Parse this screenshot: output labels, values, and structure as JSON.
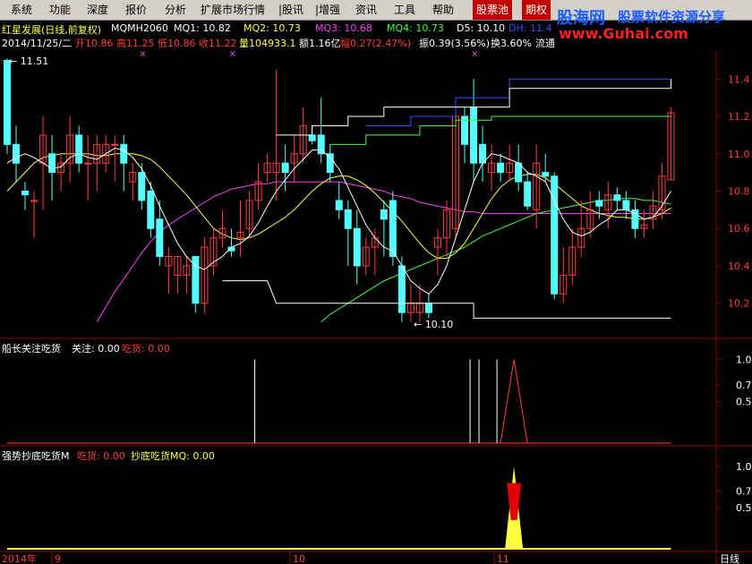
{
  "menu": [
    "系统",
    "功能",
    "深度",
    "报价",
    "分析",
    "扩展市场行情",
    "|股讯",
    "|增强",
    "资讯",
    "工具",
    "帮助",
    "股票池",
    "期权"
  ],
  "watermark": {
    "brand": "股海网",
    "slogan": "股票软件资源分享",
    "url": "www.Guhai.com"
  },
  "header": {
    "title": "红星发展(日线,前复权)",
    "mqmh": "MQMH2060",
    "mq1": "MQ1: 10.82",
    "mq2": "MQ2: 10.73",
    "mq3": "MQ3: 10.68",
    "mq4": "MQ4: 10.73",
    "d5": "D5: 10.10",
    "dh": "DH: 11.4"
  },
  "quote": {
    "date": "2014/11/25/二",
    "open": "开10.86",
    "high": "高11.25",
    "low": "低10.86",
    "close": "收11.22",
    "volume": "量104933.1",
    "amount": "额1.16亿",
    "change": "幅0.27(2.47%)",
    "swing": "振0.39(3.56%)",
    "turnover": "换3.60%",
    "float": "流通"
  },
  "annotations": {
    "max_label": "11.51",
    "min_label": "10.10"
  },
  "panel2": {
    "title": "船长关注吃货",
    "attention": "关注: 0.00",
    "eat": "吃货: 0.00"
  },
  "panel3": {
    "title": "强势抄底吃货M",
    "eat": "吃货: 0.00",
    "bottom": "抄底吃货MQ: 0.00"
  },
  "bottom_axis": {
    "year": "2014年",
    "months": [
      "9",
      "10",
      "11"
    ],
    "period": "日线"
  },
  "colors": {
    "up": "#ff3c3c",
    "down": "#54ffff",
    "ma_white": "#ffffff",
    "ma_yellow": "#ffff40",
    "ma_magenta": "#ff40ff",
    "ma_green": "#40ff40",
    "blue": "#3050ff",
    "grid": "#900000"
  },
  "chart_data": [
    {
      "type": "candlestick",
      "ylim": [
        10.05,
        11.55
      ],
      "yticks": [
        10.2,
        10.4,
        10.6,
        10.8,
        11.0,
        11.2,
        11.4
      ],
      "candles": [
        {
          "o": 11.5,
          "h": 11.51,
          "l": 11.0,
          "c": 11.05
        },
        {
          "o": 11.05,
          "h": 11.15,
          "l": 10.85,
          "c": 10.95
        },
        {
          "o": 10.8,
          "h": 10.85,
          "l": 10.7,
          "c": 10.78
        },
        {
          "o": 10.75,
          "h": 10.8,
          "l": 10.55,
          "c": 10.75
        },
        {
          "o": 10.95,
          "h": 11.2,
          "l": 10.7,
          "c": 11.1
        },
        {
          "o": 11.0,
          "h": 11.1,
          "l": 10.75,
          "c": 10.9
        },
        {
          "o": 10.9,
          "h": 11.0,
          "l": 10.8,
          "c": 10.95
        },
        {
          "o": 10.95,
          "h": 11.2,
          "l": 10.85,
          "c": 11.1
        },
        {
          "o": 11.1,
          "h": 11.15,
          "l": 10.9,
          "c": 10.95
        },
        {
          "o": 10.95,
          "h": 11.1,
          "l": 10.75,
          "c": 10.95
        },
        {
          "o": 10.95,
          "h": 11.1,
          "l": 10.8,
          "c": 11.05
        },
        {
          "o": 10.95,
          "h": 11.1,
          "l": 10.9,
          "c": 11.05
        },
        {
          "o": 11.05,
          "h": 11.1,
          "l": 10.85,
          "c": 11.05
        },
        {
          "o": 11.05,
          "h": 11.1,
          "l": 10.8,
          "c": 10.95
        },
        {
          "o": 10.85,
          "h": 10.95,
          "l": 10.75,
          "c": 10.9
        },
        {
          "o": 10.9,
          "h": 10.95,
          "l": 10.7,
          "c": 10.75
        },
        {
          "o": 10.8,
          "h": 10.85,
          "l": 10.55,
          "c": 10.6
        },
        {
          "o": 10.65,
          "h": 10.75,
          "l": 10.4,
          "c": 10.45
        },
        {
          "o": 10.4,
          "h": 10.5,
          "l": 10.25,
          "c": 10.45
        },
        {
          "o": 10.35,
          "h": 10.45,
          "l": 10.25,
          "c": 10.45
        },
        {
          "o": 10.35,
          "h": 10.45,
          "l": 10.25,
          "c": 10.4
        },
        {
          "o": 10.45,
          "h": 10.45,
          "l": 10.15,
          "c": 10.2
        },
        {
          "o": 10.2,
          "h": 10.55,
          "l": 10.15,
          "c": 10.5
        },
        {
          "o": 10.4,
          "h": 10.6,
          "l": 10.35,
          "c": 10.55
        },
        {
          "o": 10.55,
          "h": 10.7,
          "l": 10.5,
          "c": 10.6
        },
        {
          "o": 10.5,
          "h": 10.6,
          "l": 10.45,
          "c": 10.48
        },
        {
          "o": 10.55,
          "h": 10.75,
          "l": 10.45,
          "c": 10.58
        },
        {
          "o": 10.6,
          "h": 10.8,
          "l": 10.55,
          "c": 10.75
        },
        {
          "o": 10.75,
          "h": 10.95,
          "l": 10.7,
          "c": 10.85
        },
        {
          "o": 10.9,
          "h": 11.0,
          "l": 10.85,
          "c": 10.95
        },
        {
          "o": 10.9,
          "h": 11.45,
          "l": 10.75,
          "c": 10.95
        },
        {
          "o": 10.95,
          "h": 11.05,
          "l": 10.8,
          "c": 10.9
        },
        {
          "o": 10.95,
          "h": 11.1,
          "l": 10.85,
          "c": 11.0
        },
        {
          "o": 11.0,
          "h": 11.25,
          "l": 10.95,
          "c": 11.15
        },
        {
          "o": 11.1,
          "h": 11.15,
          "l": 11.05,
          "c": 11.07
        },
        {
          "o": 11.1,
          "h": 11.3,
          "l": 10.95,
          "c": 11.0
        },
        {
          "o": 11.0,
          "h": 11.05,
          "l": 10.85,
          "c": 10.9
        },
        {
          "o": 10.75,
          "h": 10.85,
          "l": 10.65,
          "c": 10.7
        },
        {
          "o": 10.7,
          "h": 10.75,
          "l": 10.4,
          "c": 10.6
        },
        {
          "o": 10.6,
          "h": 10.7,
          "l": 10.3,
          "c": 10.4
        },
        {
          "o": 10.4,
          "h": 10.55,
          "l": 10.35,
          "c": 10.5
        },
        {
          "o": 10.5,
          "h": 10.6,
          "l": 10.35,
          "c": 10.55
        },
        {
          "o": 10.7,
          "h": 10.75,
          "l": 10.45,
          "c": 10.65
        },
        {
          "o": 10.75,
          "h": 10.8,
          "l": 10.4,
          "c": 10.45
        },
        {
          "o": 10.4,
          "h": 10.45,
          "l": 10.1,
          "c": 10.15
        },
        {
          "o": 10.15,
          "h": 10.3,
          "l": 10.1,
          "c": 10.2
        },
        {
          "o": 10.15,
          "h": 10.3,
          "l": 10.1,
          "c": 10.2
        },
        {
          "o": 10.2,
          "h": 10.25,
          "l": 10.12,
          "c": 10.15
        },
        {
          "o": 10.5,
          "h": 10.6,
          "l": 10.35,
          "c": 10.55
        },
        {
          "o": 10.55,
          "h": 10.75,
          "l": 10.45,
          "c": 10.7
        },
        {
          "o": 10.6,
          "h": 11.25,
          "l": 10.55,
          "c": 11.2
        },
        {
          "o": 11.2,
          "h": 11.25,
          "l": 10.95,
          "c": 11.05
        },
        {
          "o": 11.25,
          "h": 11.4,
          "l": 10.85,
          "c": 10.95
        },
        {
          "o": 11.05,
          "h": 11.15,
          "l": 10.85,
          "c": 10.95
        },
        {
          "o": 10.9,
          "h": 11.05,
          "l": 10.8,
          "c": 10.95
        },
        {
          "o": 10.95,
          "h": 11.0,
          "l": 10.85,
          "c": 10.9
        },
        {
          "o": 10.9,
          "h": 11.05,
          "l": 10.85,
          "c": 10.95
        },
        {
          "o": 10.95,
          "h": 11.05,
          "l": 10.8,
          "c": 10.85
        },
        {
          "o": 10.85,
          "h": 10.9,
          "l": 10.7,
          "c": 10.72
        },
        {
          "o": 10.7,
          "h": 11.05,
          "l": 10.6,
          "c": 10.95
        },
        {
          "o": 10.9,
          "h": 11.0,
          "l": 10.85,
          "c": 10.88
        },
        {
          "o": 10.88,
          "h": 10.9,
          "l": 10.22,
          "c": 10.25
        },
        {
          "o": 10.25,
          "h": 10.5,
          "l": 10.2,
          "c": 10.35
        },
        {
          "o": 10.35,
          "h": 10.6,
          "l": 10.3,
          "c": 10.5
        },
        {
          "o": 10.5,
          "h": 10.75,
          "l": 10.45,
          "c": 10.6
        },
        {
          "o": 10.6,
          "h": 10.8,
          "l": 10.55,
          "c": 10.7
        },
        {
          "o": 10.75,
          "h": 10.8,
          "l": 10.65,
          "c": 10.72
        },
        {
          "o": 10.7,
          "h": 10.85,
          "l": 10.6,
          "c": 10.78
        },
        {
          "o": 10.78,
          "h": 10.82,
          "l": 10.7,
          "c": 10.75
        },
        {
          "o": 10.75,
          "h": 10.8,
          "l": 10.65,
          "c": 10.7
        },
        {
          "o": 10.7,
          "h": 10.75,
          "l": 10.55,
          "c": 10.6
        },
        {
          "o": 10.6,
          "h": 10.7,
          "l": 10.55,
          "c": 10.62
        },
        {
          "o": 10.65,
          "h": 10.8,
          "l": 10.6,
          "c": 10.72
        },
        {
          "o": 10.7,
          "h": 10.95,
          "l": 10.65,
          "c": 10.88
        },
        {
          "o": 10.86,
          "h": 11.25,
          "l": 10.86,
          "c": 11.22
        }
      ],
      "lines": [
        {
          "name": "MQ4",
          "color": "#3050ff",
          "step": true,
          "points": [
            [
              40,
              11.15
            ],
            [
              45,
              11.2
            ],
            [
              50,
              11.3
            ],
            [
              56,
              11.4
            ],
            [
              74,
              11.4
            ]
          ]
        },
        {
          "name": "D5",
          "color": "#ffffff",
          "step": true,
          "points": [
            [
              30,
              11.1
            ],
            [
              34,
              11.15
            ],
            [
              38,
              11.2
            ],
            [
              42,
              11.25
            ],
            [
              48,
              11.25
            ],
            [
              56,
              11.35
            ],
            [
              74,
              11.4
            ]
          ]
        },
        {
          "name": "MQ2",
          "color": "#40ff40",
          "step": true,
          "points": [
            [
              36,
              11.05
            ],
            [
              40,
              11.1
            ],
            [
              46,
              11.15
            ],
            [
              50,
              11.18
            ],
            [
              54,
              11.2
            ],
            [
              74,
              11.2
            ]
          ]
        }
      ],
      "ma_white": [
        10.95,
        10.98,
        11.0,
        10.98,
        10.95,
        10.92,
        10.93,
        10.98,
        11.0,
        10.98,
        10.97,
        11.0,
        11.03,
        11.02,
        10.98,
        10.92,
        10.83,
        10.72,
        10.62,
        10.52,
        10.45,
        10.4,
        10.38,
        10.42,
        10.45,
        10.5,
        10.52,
        10.56,
        10.63,
        10.72,
        10.8,
        10.86,
        10.92,
        10.97,
        11.02,
        11.02,
        10.98,
        10.92,
        10.82,
        10.72,
        10.62,
        10.55,
        10.5,
        10.48,
        10.4,
        10.32,
        10.28,
        10.25,
        10.3,
        10.4,
        10.55,
        10.7,
        10.85,
        10.95,
        11.0,
        10.99,
        10.97,
        10.95,
        10.9,
        10.88,
        10.85,
        10.75,
        10.65,
        10.58,
        10.56,
        10.58,
        10.62,
        10.65,
        10.7,
        10.7,
        10.68,
        10.65,
        10.66,
        10.72,
        10.8
      ],
      "ma_yellow": [
        10.8,
        10.85,
        10.9,
        10.95,
        10.98,
        10.99,
        11.0,
        11.0,
        11.0,
        11.0,
        10.99,
        10.99,
        11.0,
        11.0,
        11.0,
        10.99,
        10.97,
        10.93,
        10.88,
        10.83,
        10.78,
        10.72,
        10.66,
        10.6,
        10.57,
        10.55,
        10.54,
        10.55,
        10.57,
        10.6,
        10.63,
        10.66,
        10.7,
        10.75,
        10.8,
        10.84,
        10.87,
        10.88,
        10.88,
        10.86,
        10.83,
        10.79,
        10.74,
        10.69,
        10.64,
        10.58,
        10.52,
        10.47,
        10.44,
        10.44,
        10.47,
        10.52,
        10.6,
        10.68,
        10.76,
        10.82,
        10.86,
        10.88,
        10.89,
        10.89,
        10.87,
        10.84,
        10.8,
        10.76,
        10.72,
        10.7,
        10.68,
        10.67,
        10.66,
        10.66,
        10.65,
        10.65,
        10.66,
        10.68,
        10.71
      ],
      "ma_magenta": [
        null,
        null,
        null,
        null,
        null,
        null,
        null,
        null,
        null,
        null,
        10.1,
        10.18,
        10.26,
        10.33,
        10.4,
        10.47,
        10.53,
        10.58,
        10.62,
        10.65,
        10.68,
        10.71,
        10.74,
        10.77,
        10.79,
        10.81,
        10.82,
        10.83,
        10.84,
        10.84,
        10.85,
        10.85,
        10.85,
        10.85,
        10.85,
        10.85,
        10.85,
        10.85,
        10.84,
        10.83,
        10.82,
        10.81,
        10.8,
        10.78,
        10.77,
        10.76,
        10.74,
        10.73,
        10.72,
        10.71,
        10.7,
        10.69,
        10.69,
        10.68,
        10.68,
        10.68,
        10.68,
        10.68,
        10.68,
        10.68,
        10.68,
        10.68,
        10.68,
        10.68,
        10.68,
        10.68,
        10.68,
        10.68,
        10.68,
        10.68,
        10.68,
        10.68,
        10.68,
        10.68,
        10.68
      ],
      "ma_green": [
        null,
        null,
        null,
        null,
        null,
        null,
        null,
        null,
        null,
        null,
        null,
        null,
        null,
        null,
        null,
        null,
        null,
        null,
        null,
        null,
        null,
        null,
        null,
        null,
        null,
        null,
        null,
        null,
        null,
        null,
        null,
        null,
        null,
        null,
        null,
        10.1,
        10.14,
        10.17,
        10.2,
        10.23,
        10.26,
        10.29,
        10.32,
        10.34,
        10.36,
        10.38,
        10.4,
        10.42,
        10.44,
        10.46,
        10.48,
        10.5,
        10.53,
        10.56,
        10.58,
        10.6,
        10.62,
        10.64,
        10.66,
        10.68,
        10.69,
        10.7,
        10.71,
        10.72,
        10.73,
        10.74,
        10.75,
        10.75,
        10.76,
        10.76,
        10.76,
        10.75,
        10.75,
        10.74,
        10.73
      ],
      "markers": [
        {
          "i": 15,
          "y": 11.51
        },
        {
          "i": 25,
          "y": 11.51
        },
        {
          "i": 52,
          "y": 11.51
        }
      ]
    },
    {
      "type": "bar",
      "title": "船长关注吃货",
      "ylim": [
        0,
        1.1
      ],
      "yticks": [
        1.0,
        0.7,
        0.5
      ],
      "white_bars": [
        28,
        52,
        53,
        55
      ],
      "red_triangle": {
        "start": 55,
        "peak": 56.5,
        "end": 58,
        "value": 1.0
      }
    },
    {
      "type": "area",
      "title": "强势抄底吃货M",
      "ylim": [
        0,
        1.1
      ],
      "yticks": [
        1.0,
        0.7,
        0.5
      ],
      "yellow_triangle": {
        "start": 55.5,
        "peak": 56.5,
        "end": 57.5,
        "value": 1.0
      },
      "red_band": [
        0.35,
        0.8
      ]
    }
  ]
}
